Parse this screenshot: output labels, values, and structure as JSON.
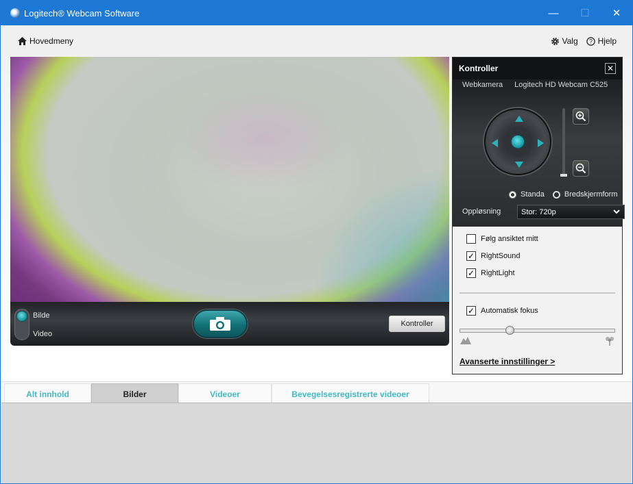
{
  "window": {
    "title": "Logitech® Webcam Software",
    "minimize": "—",
    "maximize": "☐",
    "close": "✕"
  },
  "nav": {
    "home_label": "Hovedmeny",
    "options_label": "Valg",
    "help_label": "Hjelp"
  },
  "capture_bar": {
    "mode_photo": "Bilde",
    "mode_video": "Video",
    "controls_button": "Kontroller"
  },
  "panel": {
    "title": "Kontroller",
    "close": "✕",
    "camera_label": "Webkamera",
    "camera_name": "Logitech HD Webcam C525",
    "aspect_standard": "Standa",
    "aspect_wide": "Bredskjermform",
    "resolution_label": "Oppløsning",
    "resolution_value": "Stor: 720p",
    "follow_face": "Følg ansiktet mitt",
    "right_sound": "RightSound",
    "right_light": "RightLight",
    "auto_focus": "Automatisk fokus",
    "checked_mark": "✓",
    "advanced_link": "Avanserte innstillinger >"
  },
  "tabs": [
    {
      "label": "Alt innhold"
    },
    {
      "label": "Bilder"
    },
    {
      "label": "Videoer"
    },
    {
      "label": "Bevegelsesregistrerte videoer"
    }
  ],
  "colors": {
    "titlebar": "#1c78d4",
    "accent_teal": "#27b3bb",
    "tab_text": "#3fb9c6"
  },
  "icons": {
    "home": "home-icon",
    "options": "gear-icon",
    "help": "help-icon",
    "capture": "camera-icon",
    "zoom_in": "zoom-in-icon",
    "zoom_out": "zoom-out-icon",
    "focus_near": "mountain-icon",
    "focus_far": "flower-icon"
  }
}
